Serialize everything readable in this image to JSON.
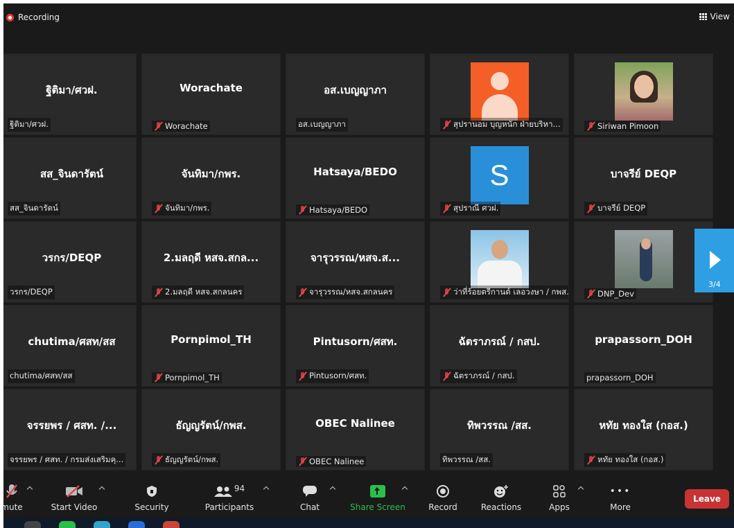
{
  "top_bar": {
    "recording_label": "Recording",
    "view_label": "View"
  },
  "tiles": [
    {
      "big": "ฐิติมา/ศวฝ.",
      "label": "ฐิติมา/ศวฝ.",
      "muted": false,
      "avatar": ""
    },
    {
      "big": "Worachate",
      "label": "Worachate",
      "muted": true,
      "avatar": ""
    },
    {
      "big": "อส.เบญญาภา",
      "label": "อส.เบญญาภา",
      "muted": false,
      "avatar": ""
    },
    {
      "big": "",
      "label": "สุปรานอม บุญหนัก ฝ่ายบริหา...",
      "muted": true,
      "avatar": "orange"
    },
    {
      "big": "",
      "label": "Siriwan Pimoon",
      "muted": true,
      "avatar": "photo1"
    },
    {
      "big": "สส_จินดารัตน์",
      "label": "สส_จินดารัตน์",
      "muted": false,
      "avatar": ""
    },
    {
      "big": "จันทิมา/กพร.",
      "label": "จันทิมา/กพร.",
      "muted": true,
      "avatar": ""
    },
    {
      "big": "Hatsaya/BEDO",
      "label": "Hatsaya/BEDO",
      "muted": true,
      "avatar": ""
    },
    {
      "big": "",
      "label": "สุปราณี ศวฝ.",
      "muted": true,
      "avatar": "blue",
      "initial": "S"
    },
    {
      "big": "บาจรีย์ DEQP",
      "label": "บาจรีย์ DEQP",
      "muted": true,
      "avatar": ""
    },
    {
      "big": "วรกร/DEQP",
      "label": "วรกร/DEQP",
      "muted": false,
      "avatar": ""
    },
    {
      "big": "2.มลฤดี หสจ.สกล...",
      "label": "2.มลฤดี หสจ.สกลนคร",
      "muted": true,
      "avatar": ""
    },
    {
      "big": "จารุวรรณ/หสจ.ส...",
      "label": "จารุวรรณ/หสจ.สกลนคร",
      "muted": true,
      "avatar": ""
    },
    {
      "big": "",
      "label": "ว่าที่ร้อยตรีกานต์ เลอวงษา / กพส.",
      "muted": true,
      "avatar": "photo2"
    },
    {
      "big": "",
      "label": "DNP_Dev",
      "muted": true,
      "avatar": "photo3"
    },
    {
      "big": "chutima/ศสท/สส",
      "label": "chutima/ศสท/สส",
      "muted": false,
      "avatar": ""
    },
    {
      "big": "Pornpimol_TH",
      "label": "Pornpimol_TH",
      "muted": true,
      "avatar": ""
    },
    {
      "big": "Pintusorn/ศสท.",
      "label": "Pintusorn/ศสท.",
      "muted": true,
      "avatar": ""
    },
    {
      "big": "ฉัตราภรณ์ / กสป.",
      "label": "ฉัตราภรณ์ / กสป.",
      "muted": true,
      "avatar": ""
    },
    {
      "big": "prapassorn_DOH",
      "label": "prapassorn_DOH",
      "muted": false,
      "avatar": ""
    },
    {
      "big": "จรรยพร / ศสท. /...",
      "label": "จรรยพร / ศสท. / กรมส่งเสริมคุ...",
      "muted": false,
      "avatar": ""
    },
    {
      "big": "ธัญญรัตน์/กพส.",
      "label": "ธัญญรัตน์/กพส.",
      "muted": true,
      "avatar": ""
    },
    {
      "big": "OBEC Nalinee",
      "label": "OBEC Nalinee",
      "muted": true,
      "avatar": ""
    },
    {
      "big": "ทิพวรรณ /สส.",
      "label": "ทิพวรรณ /สส.",
      "muted": false,
      "avatar": ""
    },
    {
      "big": "หทัย ทองใส (กอส.)",
      "label": "หทัย ทองใส (กอส.)",
      "muted": true,
      "avatar": ""
    }
  ],
  "pager": {
    "label": "3/4"
  },
  "toolbar": {
    "mute": "mute",
    "start_video": "Start Video",
    "security": "Security",
    "participants": "Participants",
    "participants_count": "94",
    "chat": "Chat",
    "share_screen": "Share Screen",
    "record": "Record",
    "reactions": "Reactions",
    "apps": "Apps",
    "more": "More",
    "leave": "Leave"
  },
  "colors": {
    "accent": "#2e9fe3",
    "share": "#2bbf4a",
    "leave": "#c83434",
    "record_dot": "#e53935"
  }
}
